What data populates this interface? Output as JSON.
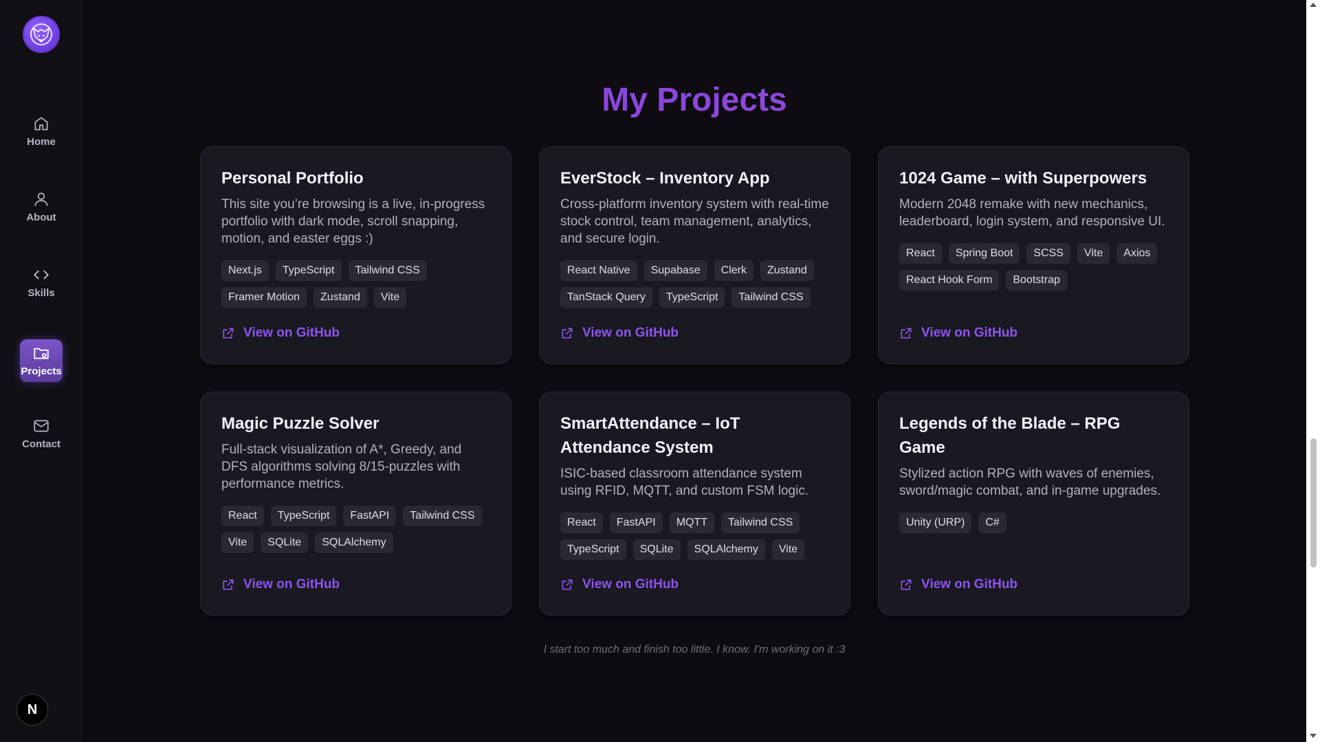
{
  "sidebar": {
    "items": [
      {
        "label": "Home",
        "icon": "home-icon"
      },
      {
        "label": "About",
        "icon": "user-icon"
      },
      {
        "label": "Skills",
        "icon": "code-icon"
      },
      {
        "label": "Projects",
        "icon": "folder-icon",
        "active": true
      },
      {
        "label": "Contact",
        "icon": "mail-icon"
      }
    ],
    "bottom_avatar": "N"
  },
  "page": {
    "title": "My Projects",
    "footnote": "I start too much and finish too little. I know. I'm working on it :3"
  },
  "projects": [
    {
      "title": "Personal Portfolio",
      "description": "This site you’re browsing is a live, in-progress portfolio with dark mode, scroll snapping, motion, and easter eggs :)",
      "tags": [
        "Next.js",
        "TypeScript",
        "Tailwind CSS",
        "Framer Motion",
        "Zustand",
        "Vite"
      ],
      "link": "View on GitHub"
    },
    {
      "title": "EverStock – Inventory App",
      "description": "Cross-platform inventory system with real-time stock control, team management, analytics, and secure login.",
      "tags": [
        "React Native",
        "Supabase",
        "Clerk",
        "Zustand",
        "TanStack Query",
        "TypeScript",
        "Tailwind CSS"
      ],
      "link": "View on GitHub"
    },
    {
      "title": "1024 Game – with Superpowers",
      "description": "Modern 2048 remake with new mechanics, leaderboard, login system, and responsive UI.",
      "tags": [
        "React",
        "Spring Boot",
        "SCSS",
        "Vite",
        "Axios",
        "React Hook Form",
        "Bootstrap"
      ],
      "link": "View on GitHub"
    },
    {
      "title": "Magic Puzzle Solver",
      "description": "Full-stack visualization of A*, Greedy, and DFS algorithms solving 8/15-puzzles with performance metrics.",
      "tags": [
        "React",
        "TypeScript",
        "FastAPI",
        "Tailwind CSS",
        "Vite",
        "SQLite",
        "SQLAlchemy"
      ],
      "link": "View on GitHub"
    },
    {
      "title": "SmartAttendance – IoT Attendance System",
      "description": "ISIC-based classroom attendance system using RFID, MQTT, and custom FSM logic.",
      "tags": [
        "React",
        "FastAPI",
        "MQTT",
        "Tailwind CSS",
        "TypeScript",
        "SQLite",
        "SQLAlchemy",
        "Vite"
      ],
      "link": "View on GitHub"
    },
    {
      "title": "Legends of the Blade – RPG Game",
      "description": "Stylized action RPG with waves of enemies, sword/magic combat, and in-game upgrades.",
      "tags": [
        "Unity (URP)",
        "C#"
      ],
      "link": "View on GitHub"
    }
  ],
  "colors": {
    "accent": "#8b55ee",
    "background": "#0e0c11",
    "card": "#1a1820"
  }
}
